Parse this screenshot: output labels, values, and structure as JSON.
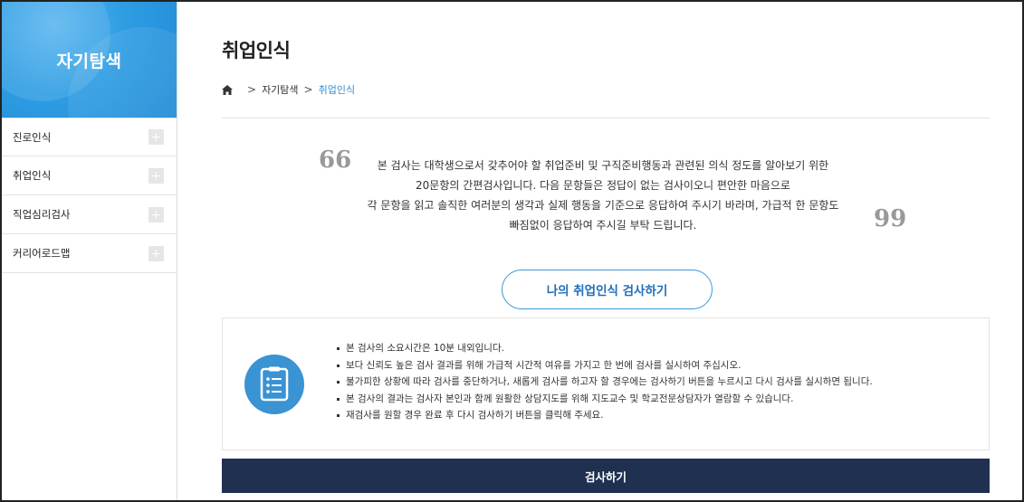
{
  "sidebar": {
    "title": "자기탐색",
    "items": [
      {
        "label": "진로인식"
      },
      {
        "label": "취업인식"
      },
      {
        "label": "직업심리검사"
      },
      {
        "label": "커리어로드맵"
      }
    ]
  },
  "header": {
    "title": "취업인식",
    "breadcrumb": {
      "home_icon": "home-icon",
      "items": [
        "자기탐색",
        "취업인식"
      ]
    }
  },
  "intro": {
    "open_quote": "66",
    "close_quote": "99",
    "lines": [
      "본 검사는 대학생으로서 갖추어야 할 취업준비 및 구직준비행동과 관련된 의식 정도를 알아보기 위한",
      "20문항의 간편검사입니다. 다음 문항들은 정답이 없는 검사이오니 편안한 마음으로",
      "각 문항을 읽고 솔직한 여러분의 생각과 실제 행동을 기준으로 응답하여 주시기 바라며, 가급적 한 문항도",
      "빠짐없이 응답하여 주시길 부탁 드립니다."
    ]
  },
  "test_button": {
    "label": "나의 취업인식 검사하기"
  },
  "info": {
    "icon": "checklist-icon",
    "items": [
      "본 검사의 소요시간은 10분 내외입니다.",
      "보다 신뢰도 높은 검사 결과를 위해 가급적 시간적 여유를 가지고 한 번에 검사를 실시하여 주십시오.",
      "불가피한 상황에 따라 검사를 중단하거나, 새롭게 검사를 하고자 할 경우에는 검사하기 버튼을 누르시고 다시 검사를 실시하면 됩니다.",
      "본 검사의 결과는 검사자 본인과 함께 원활한 상담지도를 위해 지도교수 및 학교전문상담자가 열람할 수 있습니다.",
      "재검사를 원할 경우 완료 후 다시 검사하기 버튼을 클릭해 주세요."
    ]
  },
  "submit_button": {
    "label": "검사하기"
  },
  "colors": {
    "accent": "#2f8fd8",
    "sidebar_header": "#2f9de3",
    "submit_bg": "#1f3050",
    "info_icon_bg": "#3a93d2"
  }
}
